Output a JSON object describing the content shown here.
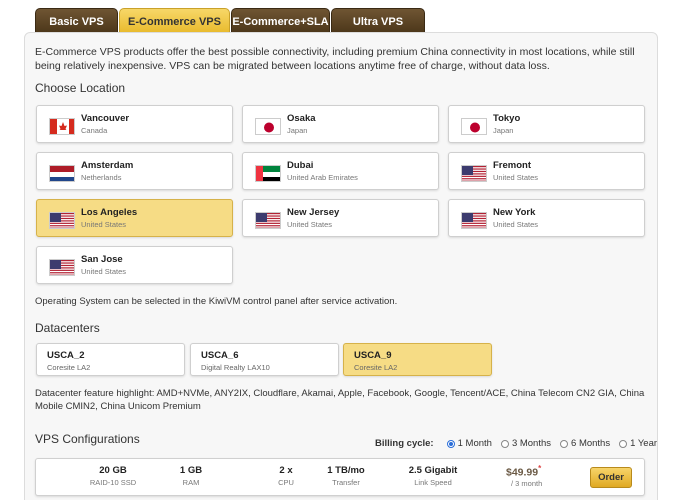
{
  "tabs": [
    {
      "label": "Basic VPS"
    },
    {
      "label": "E-Commerce VPS",
      "active": true
    },
    {
      "label": "E-Commerce+SLA"
    },
    {
      "label": "Ultra VPS"
    }
  ],
  "intro": "E-Commerce VPS products offer the best possible connectivity, including premium China connectivity in most locations, while still being relatively inexpensive. VPS can be migrated between locations anytime free of charge, without data loss.",
  "location_heading": "Choose Location",
  "locations": [
    {
      "name": "Vancouver",
      "country": "Canada",
      "flag": "canada-flag-icon"
    },
    {
      "name": "Osaka",
      "country": "Japan",
      "flag": "japan-flag-icon"
    },
    {
      "name": "Tokyo",
      "country": "Japan",
      "flag": "japan-flag-icon"
    },
    {
      "name": "Amsterdam",
      "country": "Netherlands",
      "flag": "netherlands-flag-icon"
    },
    {
      "name": "Dubai",
      "country": "United Arab Emirates",
      "flag": "uae-flag-icon"
    },
    {
      "name": "Fremont",
      "country": "United States",
      "flag": "us-flag-icon"
    },
    {
      "name": "Los Angeles",
      "country": "United States",
      "flag": "us-flag-icon",
      "selected": true
    },
    {
      "name": "New Jersey",
      "country": "United States",
      "flag": "us-flag-icon"
    },
    {
      "name": "New York",
      "country": "United States",
      "flag": "us-flag-icon"
    },
    {
      "name": "San Jose",
      "country": "United States",
      "flag": "us-flag-icon"
    }
  ],
  "os_note": "Operating System can be selected in the KiwiVM control panel after service activation.",
  "datacenter_heading": "Datacenters",
  "datacenters": [
    {
      "name": "USCA_2",
      "sub": "Coresite LA2"
    },
    {
      "name": "USCA_6",
      "sub": "Digital Realty LAX10"
    },
    {
      "name": "USCA_9",
      "sub": "Coresite LA2",
      "selected": true
    }
  ],
  "dc_note": "Datacenter feature highlight: AMD+NVMe, ANY2IX, Cloudflare, Akamai, Apple, Facebook, Google, Tencent/ACE, China Telecom CN2 GIA, China Mobile CMIN2, China Unicom Premium",
  "config_heading": "VPS Configurations",
  "billing": {
    "label": "Billing cycle:",
    "options": [
      "1 Month",
      "3 Months",
      "6 Months",
      "1 Year"
    ],
    "selected": "1 Month"
  },
  "plan": {
    "storage": "20 GB",
    "storage_label": "RAID-10 SSD",
    "ram": "1 GB",
    "ram_label": "RAM",
    "cpu": "2 x",
    "cpu_label": "CPU",
    "transfer": "1 TB/mo",
    "transfer_label": "Transfer",
    "speed": "2.5 Gigabit",
    "speed_label": "Link Speed",
    "price": "$49.99",
    "price_mark": "*",
    "period": "/ 3 month",
    "order_label": "Order"
  },
  "colors": {
    "accent": "#f6dc85",
    "tab_dark": "#4a3518",
    "selected_radio": "#2a6dd8"
  }
}
